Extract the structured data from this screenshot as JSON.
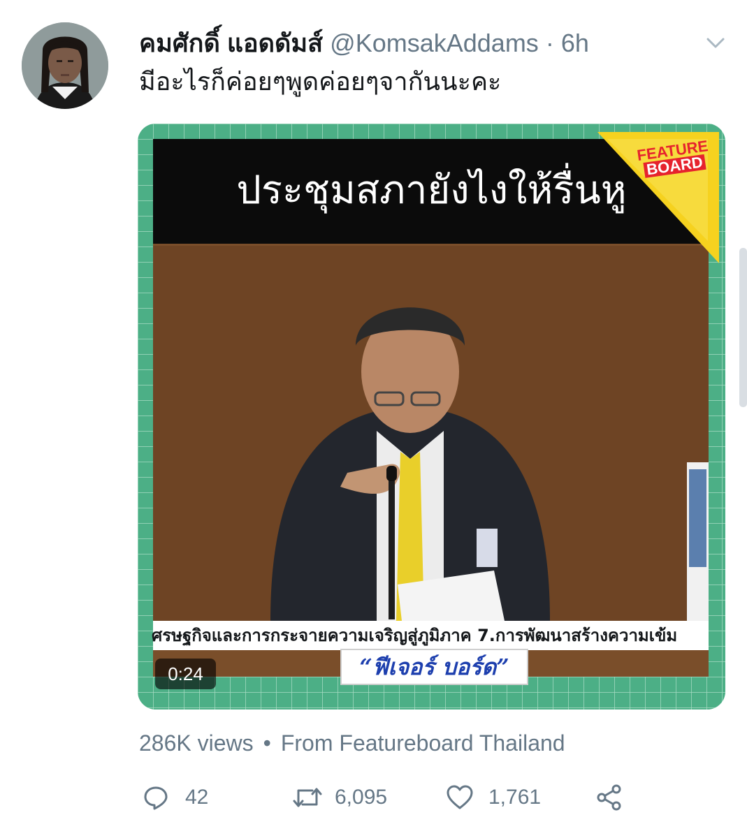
{
  "tweet": {
    "display_name": "คมศักดิ์ แอดดัมส์",
    "handle": "@KomsakAddams",
    "separator": "·",
    "time": "6h",
    "text": "มีอะไรก็ค่อยๆพูดค่อยๆจากันนะคะ"
  },
  "media": {
    "headline": "ประชุมสภายังไงให้รื่นหู",
    "logo_line1": "FEATURE",
    "logo_line2": "BOARD",
    "ticker": "ศรษฐกิจและการกระจายความเจริญสู่ภูมิภาค 7.การพัฒนาสร้างความเข้ม",
    "channel_banner": "“ฟีเจอร์ บอร์ด”",
    "duration": "0:24"
  },
  "meta": {
    "views": "286K views",
    "bullet": "•",
    "source": "From Featureboard Thailand"
  },
  "actions": {
    "replies": "42",
    "retweets": "6,095",
    "likes": "1,761"
  },
  "icons": [
    "avatar",
    "chevron-down-icon",
    "reply-icon",
    "retweet-icon",
    "like-icon",
    "share-icon"
  ],
  "colors": {
    "secondary_text": "#657786",
    "media_border": "#4caf86"
  }
}
